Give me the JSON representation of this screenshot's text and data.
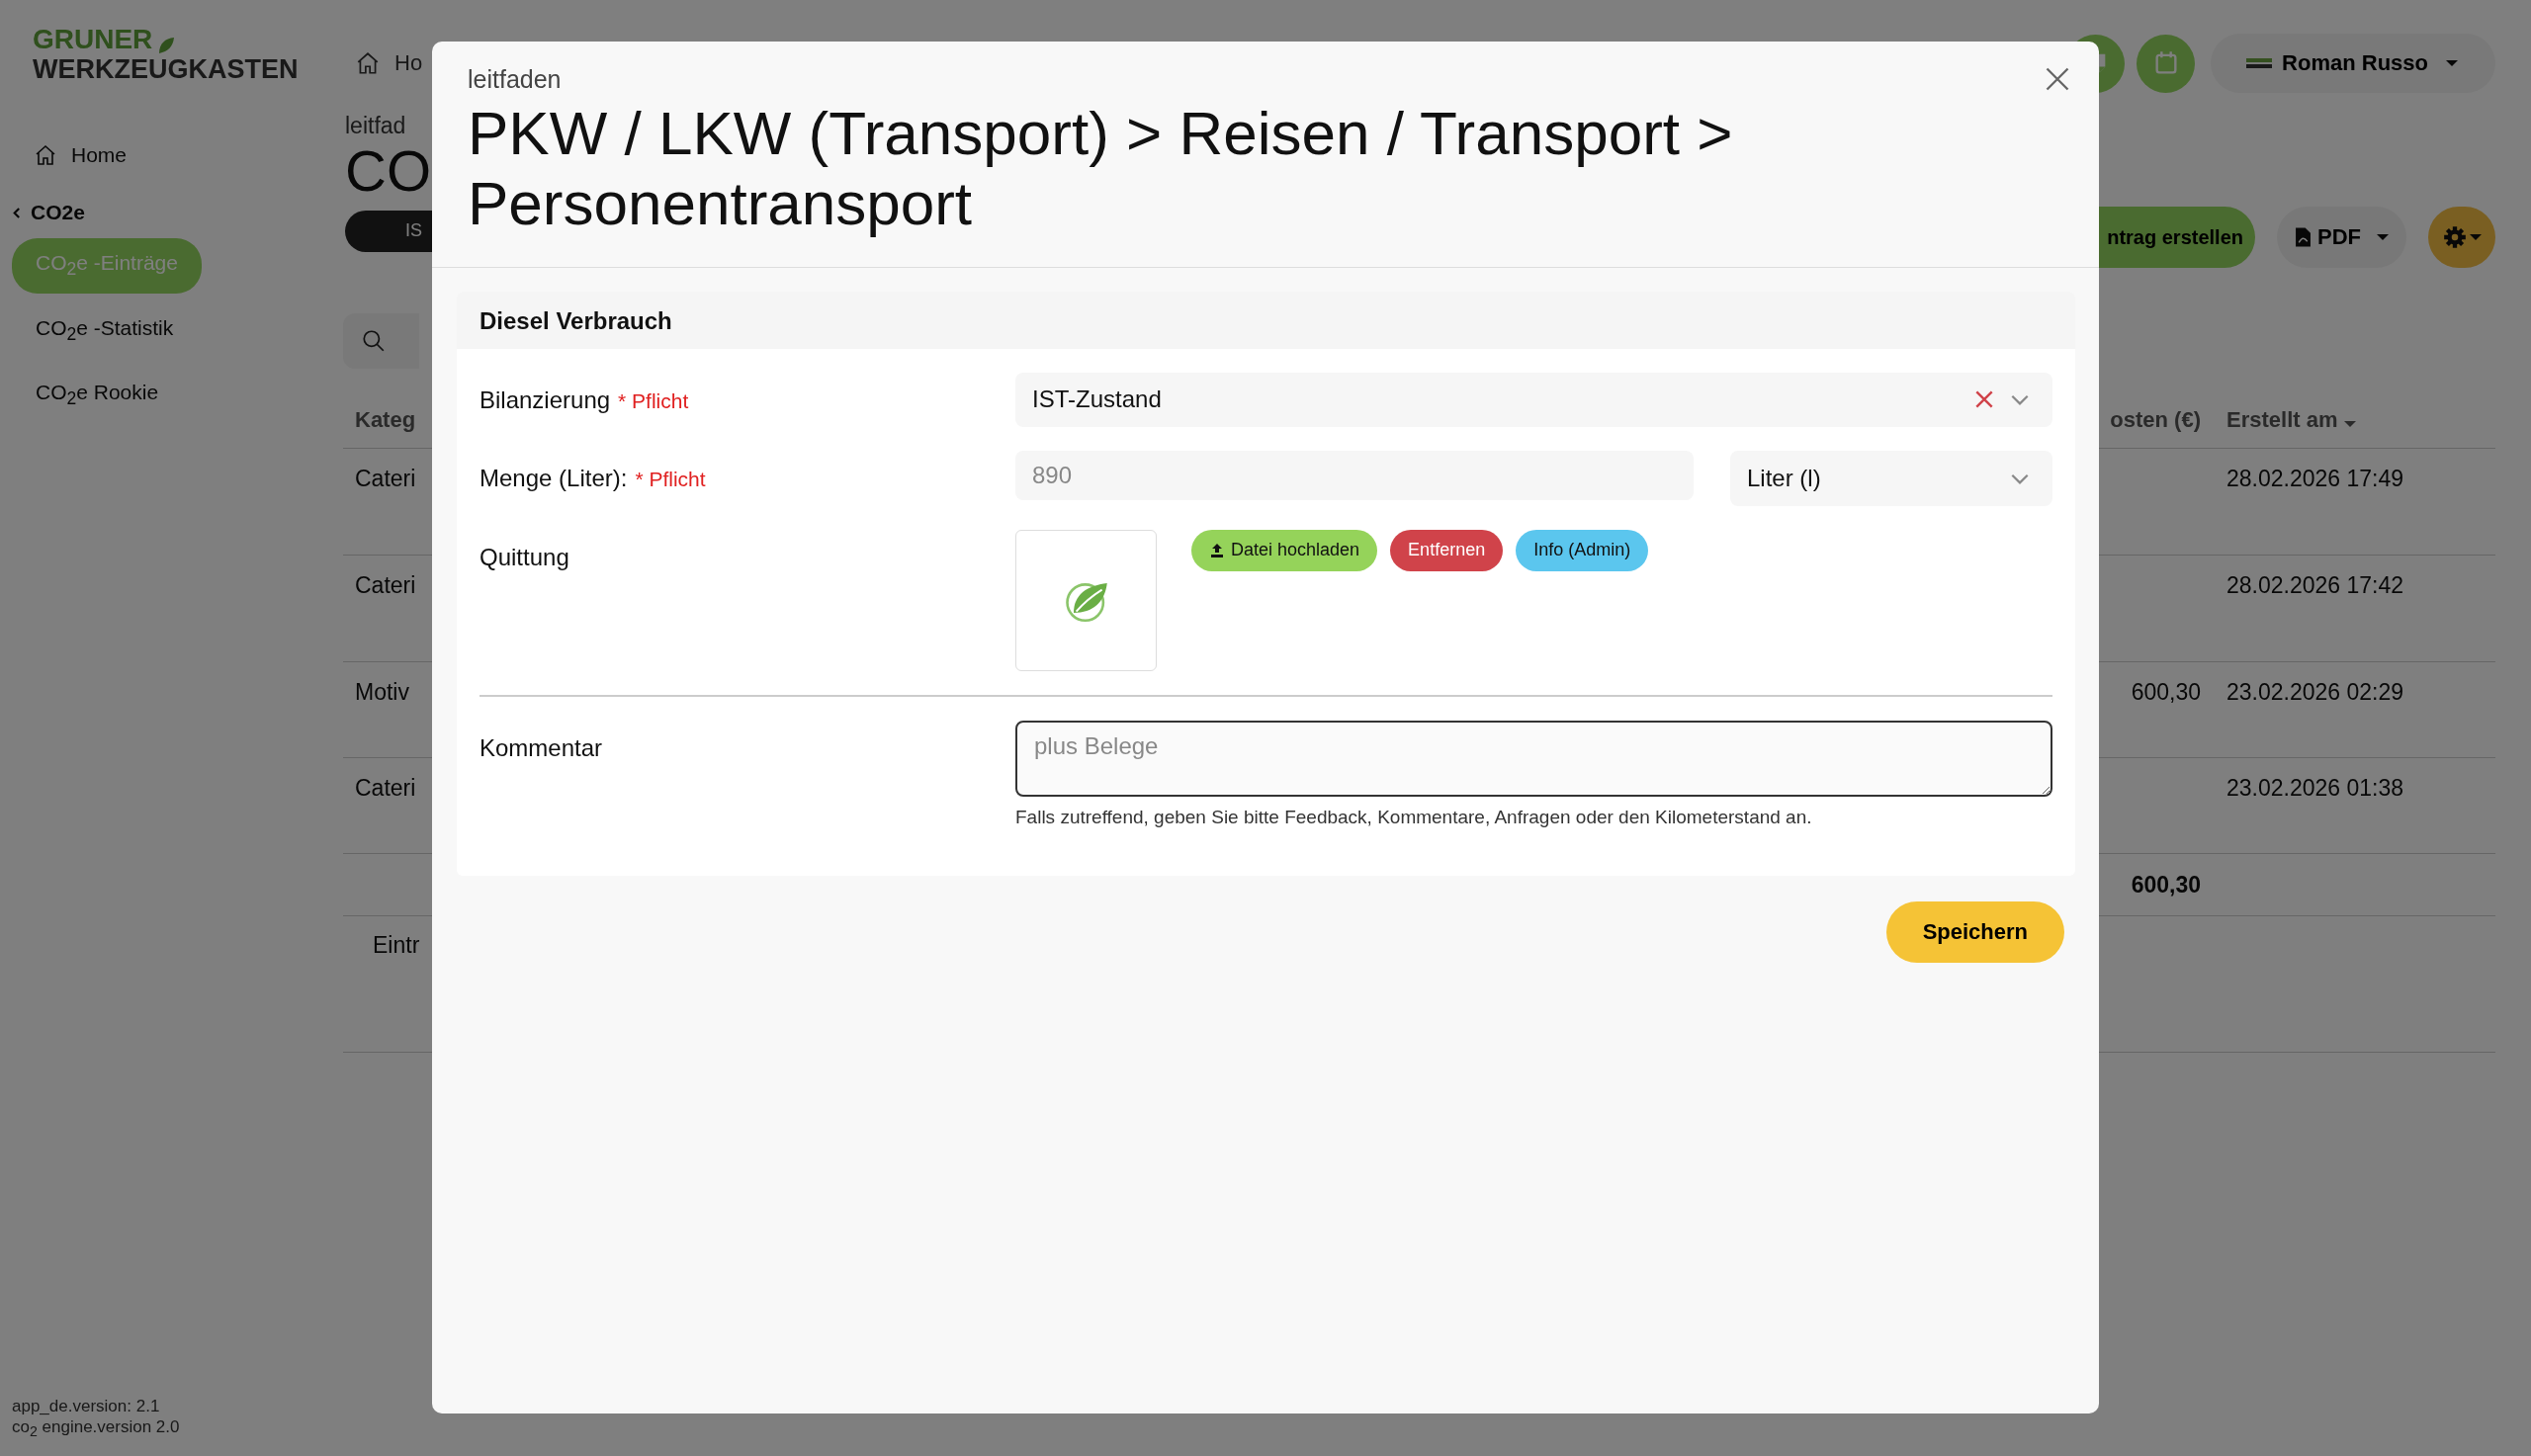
{
  "sidebar": {
    "logo_top": "GRUNER",
    "logo_bottom": "WERKZEUGKASTEN",
    "home": "Home",
    "group": {
      "label": "CO2e",
      "expanded": true
    },
    "items": [
      {
        "label": "CO$_{2}$e -Einträge",
        "selected": true
      },
      {
        "label": "CO$_{2}$e -Statistik",
        "selected": false
      },
      {
        "label": "CO$_{2}$e Rookie",
        "selected": false
      }
    ],
    "versions": [
      "app_de.version: 2.1",
      "co$_{2}$ engine.version 2.0"
    ]
  },
  "page": {
    "breadcrumb": "Ho",
    "overline": "leitfad",
    "title": "CO",
    "filter_pill": "IS",
    "user": "Roman Russo",
    "create_button": "ntrag erstellen",
    "pdf_button": "PDF",
    "table": {
      "columns": [
        "Kateg",
        "osten (€)",
        "Erstellt am"
      ],
      "rows": [
        {
          "column_1": "Cateri",
          "created": "28.02.2026 17:49"
        },
        {
          "column_1": "Cateri",
          "created": "28.02.2026 17:42"
        },
        {
          "column_1": "Motiv",
          "cost": "600,30",
          "created": "23.02.2026 02:29"
        },
        {
          "column_1": "Cateri",
          "created": "23.02.2026 01:38"
        }
      ],
      "total": "600,30",
      "footer": "Eintr"
    }
  },
  "modal": {
    "overline": "leitfaden",
    "title": "PKW / LKW (Transport) > Reisen / Transport > Personentransport",
    "section": "Diesel Verbrauch",
    "fields": [
      {
        "kind": "select",
        "label": "Bilanzierung",
        "required": "* Pflicht",
        "value": "IST-Zustand",
        "clearable": true
      },
      {
        "kind": "number",
        "label": "Menge (Liter):",
        "required": "* Pflicht",
        "placeholder": "890",
        "unit": "Liter (l)"
      },
      {
        "kind": "file",
        "label": "Quittung",
        "buttons": [
          {
            "kind": "upload",
            "label": "Datei hochladen",
            "color": "#95d35a"
          },
          {
            "kind": "plain",
            "label": "Entfernen",
            "color": "#d0434a"
          },
          {
            "kind": "plain",
            "label": "Info (Admin)",
            "color": "#5bc6ee"
          }
        ]
      },
      {
        "kind": "textarea",
        "label": "Kommentar",
        "placeholder": "plus Belege",
        "help": "Falls zutreffend, geben Sie bitte Feedback, Kommentare, Anfragen oder den Kilometerstand an."
      }
    ],
    "save": "Speichern"
  }
}
